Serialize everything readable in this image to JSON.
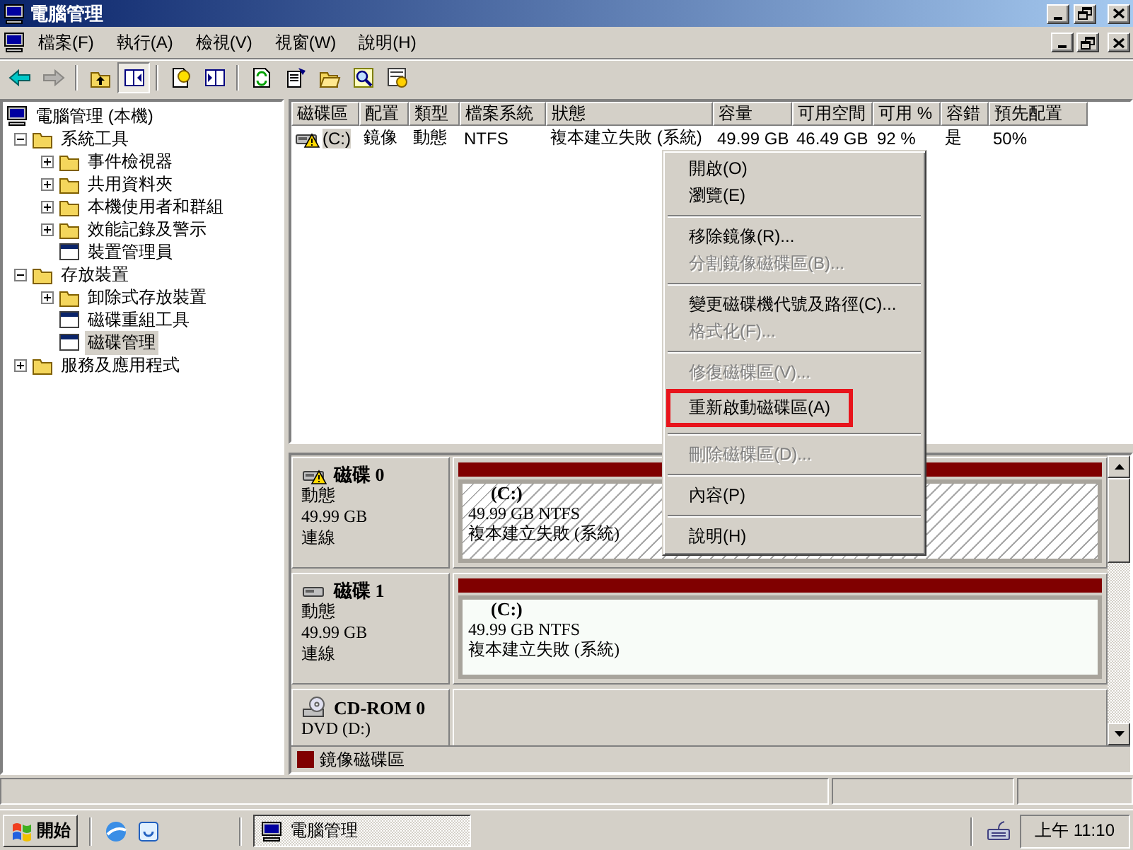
{
  "window": {
    "title": "電腦管理"
  },
  "menu_bar": [
    {
      "label": "檔案(F)"
    },
    {
      "label": "執行(A)"
    },
    {
      "label": "檢視(V)"
    },
    {
      "label": "視窗(W)"
    },
    {
      "label": "說明(H)"
    }
  ],
  "toolbar": [
    {
      "kind": "back",
      "disabled": false,
      "pressed": false
    },
    {
      "kind": "forward",
      "disabled": true,
      "pressed": false
    },
    {
      "kind": "separator"
    },
    {
      "kind": "up",
      "disabled": false,
      "pressed": false
    },
    {
      "kind": "tree",
      "disabled": false,
      "pressed": true
    },
    {
      "kind": "separator"
    },
    {
      "kind": "help",
      "disabled": false,
      "pressed": false
    },
    {
      "kind": "action",
      "disabled": false,
      "pressed": false
    },
    {
      "kind": "separator"
    },
    {
      "kind": "refresh",
      "disabled": false,
      "pressed": false
    },
    {
      "kind": "properties",
      "disabled": false,
      "pressed": false
    },
    {
      "kind": "open",
      "disabled": false,
      "pressed": false
    },
    {
      "kind": "search",
      "disabled": false,
      "pressed": false
    },
    {
      "kind": "settings",
      "disabled": false,
      "pressed": false
    }
  ],
  "tree": [
    {
      "label": "電腦管理 (本機)",
      "selected": false,
      "children": [
        {
          "label": "系統工具",
          "expanded": true,
          "selected": false,
          "children": [
            {
              "label": "事件檢視器",
              "expanded": false,
              "selected": false
            },
            {
              "label": "共用資料夾",
              "expanded": false,
              "selected": false
            },
            {
              "label": "本機使用者和群組",
              "expanded": false,
              "selected": false
            },
            {
              "label": "效能記錄及警示",
              "expanded": false,
              "selected": false
            },
            {
              "label": "裝置管理員",
              "selected": false
            }
          ]
        },
        {
          "label": "存放裝置",
          "expanded": true,
          "selected": false,
          "children": [
            {
              "label": "卸除式存放裝置",
              "expanded": false,
              "selected": false
            },
            {
              "label": "磁碟重組工具",
              "selected": false
            },
            {
              "label": "磁碟管理",
              "selected": true
            }
          ]
        },
        {
          "label": "服務及應用程式",
          "expanded": false,
          "selected": false
        }
      ]
    }
  ],
  "volume_table": {
    "columns": [
      "磁碟區",
      "配置",
      "類型",
      "檔案系統",
      "狀態",
      "容量",
      "可用空間",
      "可用 %",
      "容錯",
      "預先配置"
    ],
    "rows": [
      {
        "warning": true,
        "selected": true,
        "cells": [
          "(C:)",
          "鏡像",
          "動態",
          "NTFS",
          "複本建立失敗 (系統)",
          "49.99 GB",
          "46.49 GB",
          "92 %",
          "是",
          "50%"
        ]
      }
    ]
  },
  "disks": [
    {
      "kind": "disk",
      "name": "磁碟 0",
      "warning": true,
      "type": "動態",
      "size": "49.99 GB",
      "status": "連線",
      "volumes": [
        {
          "label": "(C:)",
          "size": "49.99 GB NTFS",
          "status": "複本建立失敗 (系統)",
          "selected": true,
          "color": "#800000"
        }
      ]
    },
    {
      "kind": "disk",
      "name": "磁碟 1",
      "warning": false,
      "type": "動態",
      "size": "49.99 GB",
      "status": "連線",
      "volumes": [
        {
          "label": "(C:)",
          "size": "49.99 GB NTFS",
          "status": "複本建立失敗 (系統)",
          "selected": false,
          "color": "#800000"
        }
      ]
    },
    {
      "kind": "cdrom",
      "name": "CD-ROM 0",
      "type": "DVD (D:)"
    }
  ],
  "legend": [
    {
      "label": "鏡像磁碟區",
      "color": "#800000"
    }
  ],
  "context_menu": [
    {
      "kind": "item",
      "label": "開啟(O)",
      "disabled": false,
      "annotated": false
    },
    {
      "kind": "item",
      "label": "瀏覽(E)",
      "disabled": false,
      "annotated": false
    },
    {
      "kind": "separator"
    },
    {
      "kind": "item",
      "label": "移除鏡像(R)...",
      "disabled": false,
      "annotated": false
    },
    {
      "kind": "item",
      "label": "分割鏡像磁碟區(B)...",
      "disabled": true,
      "annotated": false
    },
    {
      "kind": "separator"
    },
    {
      "kind": "item",
      "label": "變更磁碟機代號及路徑(C)...",
      "disabled": false,
      "annotated": false
    },
    {
      "kind": "item",
      "label": "格式化(F)...",
      "disabled": true,
      "annotated": false
    },
    {
      "kind": "separator"
    },
    {
      "kind": "item",
      "label": "修復磁碟區(V)...",
      "disabled": true,
      "annotated": false
    },
    {
      "kind": "item",
      "label": "重新啟動磁碟區(A)",
      "disabled": false,
      "annotated": true
    },
    {
      "kind": "separator"
    },
    {
      "kind": "item",
      "label": "刪除磁碟區(D)...",
      "disabled": true,
      "annotated": false
    },
    {
      "kind": "separator"
    },
    {
      "kind": "item",
      "label": "內容(P)",
      "disabled": false,
      "annotated": false
    },
    {
      "kind": "separator"
    },
    {
      "kind": "item",
      "label": "說明(H)",
      "disabled": false,
      "annotated": false
    }
  ],
  "taskbar": {
    "start": "開始",
    "tasks": [
      {
        "label": "電腦管理",
        "selected": true
      }
    ],
    "clock": "上午 11:10"
  }
}
